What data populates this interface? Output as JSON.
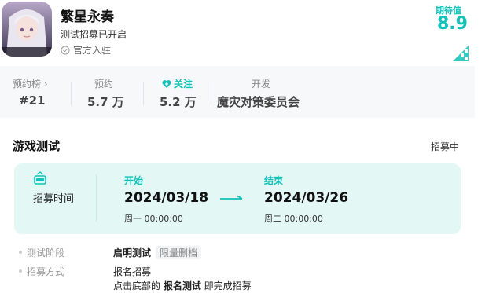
{
  "app": {
    "title": "繁星永奏",
    "subtitle": "测试招募已开启",
    "official_label": "官方入驻"
  },
  "rating": {
    "label": "期待值",
    "value": "8.9"
  },
  "stats": [
    {
      "label": "预约榜 ›",
      "value": "#21"
    },
    {
      "label": "预约",
      "value": "5.7 万"
    },
    {
      "label": "关注",
      "value": "5.2 万"
    },
    {
      "label": "开发",
      "value": "魔灾对策委员会"
    }
  ],
  "test": {
    "title": "游戏测试",
    "status": "招募中",
    "time_label": "招募时间",
    "start": {
      "label": "开始",
      "date": "2024/03/18",
      "time": "周一 00:00:00"
    },
    "end": {
      "label": "结束",
      "date": "2024/03/26",
      "time": "周二 00:00:00"
    },
    "phase_key": "测试阶段",
    "phase_value": "启明测试",
    "phase_tag": "限量删档",
    "method_key": "招募方式",
    "method_line1": "报名招募",
    "method_line2_prefix": "点击底部的 ",
    "method_line2_bold": "报名测试",
    "method_line2_suffix": " 即完成招募"
  },
  "colors": {
    "accent": "#12c2b8",
    "time_box_bg": "#e3f7f5",
    "stats_bg": "#f6f8f9"
  }
}
